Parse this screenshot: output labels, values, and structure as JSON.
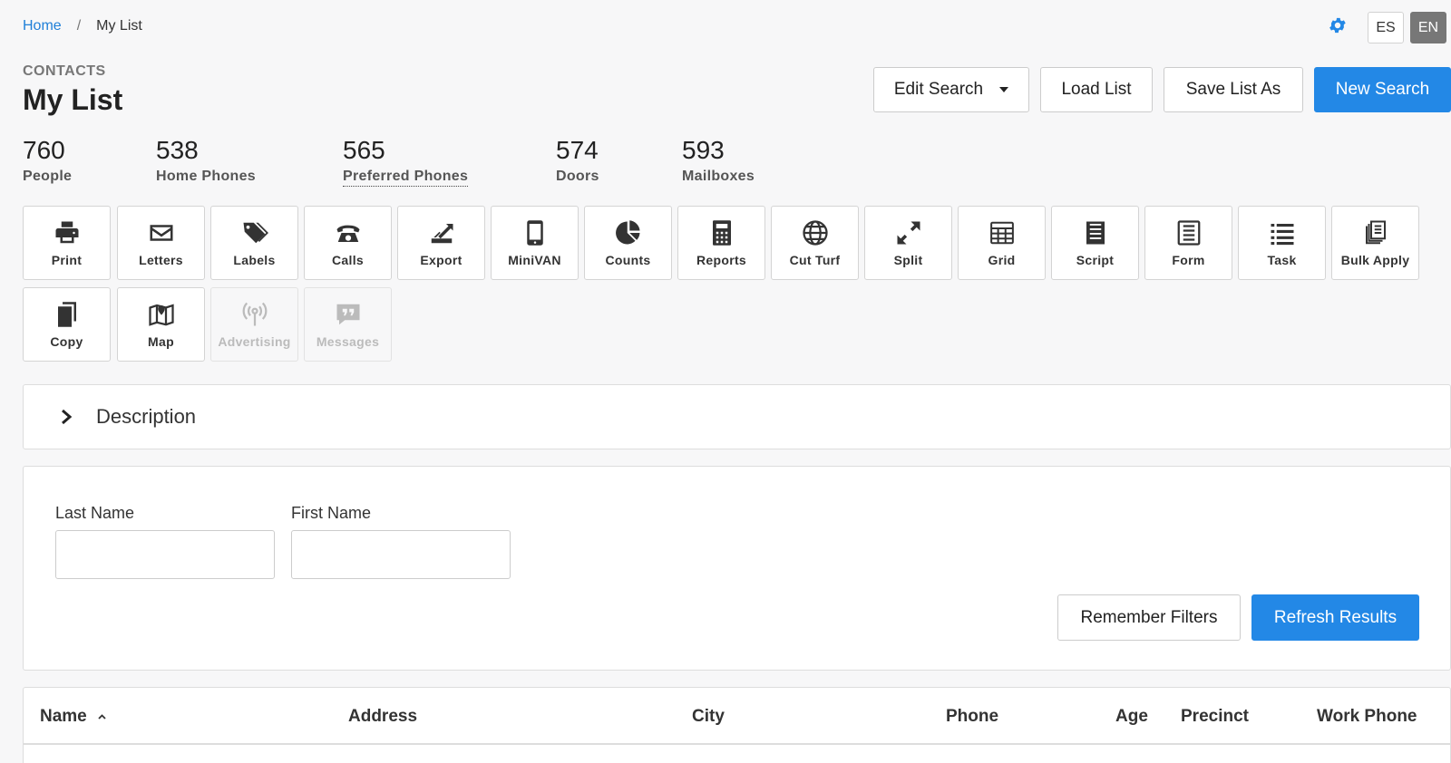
{
  "breadcrumb": {
    "home": "Home",
    "separator": "/",
    "current": "My List"
  },
  "header": {
    "settings_icon": "gear-icon",
    "languages": [
      "ES",
      "EN"
    ],
    "active_language": "EN",
    "section_label": "CONTACTS",
    "title": "My List"
  },
  "actions": {
    "edit_search": "Edit Search",
    "load_list": "Load List",
    "save_list_as": "Save List As",
    "new_search": "New Search"
  },
  "stats": [
    {
      "value": "760",
      "label": "People"
    },
    {
      "value": "538",
      "label": "Home Phones"
    },
    {
      "value": "565",
      "label": "Preferred Phones"
    },
    {
      "value": "574",
      "label": "Doors"
    },
    {
      "value": "593",
      "label": "Mailboxes"
    }
  ],
  "tools": [
    {
      "label": "Print",
      "icon": "printer-icon",
      "enabled": true
    },
    {
      "label": "Letters",
      "icon": "envelope-icon",
      "enabled": true
    },
    {
      "label": "Labels",
      "icon": "tags-icon",
      "enabled": true
    },
    {
      "label": "Calls",
      "icon": "phone-icon",
      "enabled": true
    },
    {
      "label": "Export",
      "icon": "export-icon",
      "enabled": true
    },
    {
      "label": "MiniVAN",
      "icon": "mobile-icon",
      "enabled": true
    },
    {
      "label": "Counts",
      "icon": "pie-chart-icon",
      "enabled": true
    },
    {
      "label": "Reports",
      "icon": "calculator-icon",
      "enabled": true
    },
    {
      "label": "Cut Turf",
      "icon": "globe-icon",
      "enabled": true
    },
    {
      "label": "Split",
      "icon": "expand-icon",
      "enabled": true
    },
    {
      "label": "Grid",
      "icon": "table-icon",
      "enabled": true
    },
    {
      "label": "Script",
      "icon": "script-icon",
      "enabled": true
    },
    {
      "label": "Form",
      "icon": "form-icon",
      "enabled": true
    },
    {
      "label": "Task",
      "icon": "list-icon",
      "enabled": true
    },
    {
      "label": "Bulk Apply",
      "icon": "stack-icon",
      "enabled": true
    },
    {
      "label": "Copy",
      "icon": "copy-icon",
      "enabled": true
    },
    {
      "label": "Map",
      "icon": "map-icon",
      "enabled": true
    },
    {
      "label": "Advertising",
      "icon": "broadcast-icon",
      "enabled": false
    },
    {
      "label": "Messages",
      "icon": "chat-quote-icon",
      "enabled": false
    }
  ],
  "description": {
    "label": "Description"
  },
  "filters": {
    "last_name": {
      "label": "Last Name",
      "value": "",
      "placeholder": ""
    },
    "first_name": {
      "label": "First Name",
      "value": "",
      "placeholder": ""
    },
    "remember": "Remember Filters",
    "refresh": "Refresh Results"
  },
  "table": {
    "columns": [
      "Name",
      "Address",
      "City",
      "Phone",
      "Age",
      "Precinct",
      "Work Phone"
    ],
    "sorted_column": "Name",
    "sort_direction": "ascending"
  },
  "colors": {
    "primary": "#2388e6",
    "link": "#1f7fd8",
    "text": "#222222",
    "muted": "#777777",
    "disabled": "#bbbbbb"
  }
}
